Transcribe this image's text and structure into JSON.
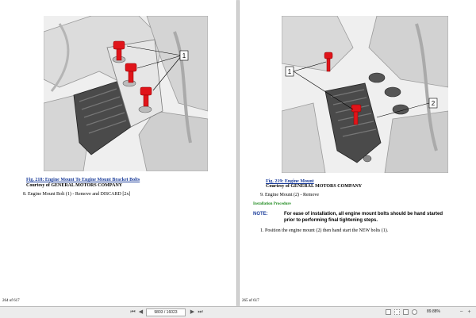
{
  "left_page": {
    "figure_caption": "Fig. 218: Engine Mount To Engine Mount Bracket Bolts",
    "courtesy": "Courtesy of GENERAL MOTORS COMPANY",
    "callouts": [
      "1"
    ],
    "step": "8. Engine Mount Bolt (1) - Remove and DISCARD [2x]",
    "page_number": "264 of 617"
  },
  "right_page": {
    "figure_caption": "Fig. 219: Engine Mount",
    "courtesy": "Courtesy of GENERAL MOTORS COMPANY",
    "callouts": [
      "1",
      "2"
    ],
    "step": "9. Engine Mount (2) - Remove",
    "procedure_heading": "Installation Procedure",
    "note_label": "NOTE:",
    "note_text": "For ease of installation, all engine mount bolts should be hand started prior to performing final tightening steps.",
    "step2": "1. Position the engine mount (2) then hand start the NEW bolts (1).",
    "page_number": "265 of 617"
  },
  "toolbar": {
    "first_icon": "first-page-icon",
    "prev_icon": "prev-page-icon",
    "page_field": "9803 / 16023",
    "next_icon": "next-page-icon",
    "last_icon": "last-page-icon",
    "zoom": "89.88%"
  },
  "colors": {
    "bolt_red": "#e0141a",
    "caption_blue": "#1a3c9a",
    "procedure_green": "#1e8a1e"
  }
}
